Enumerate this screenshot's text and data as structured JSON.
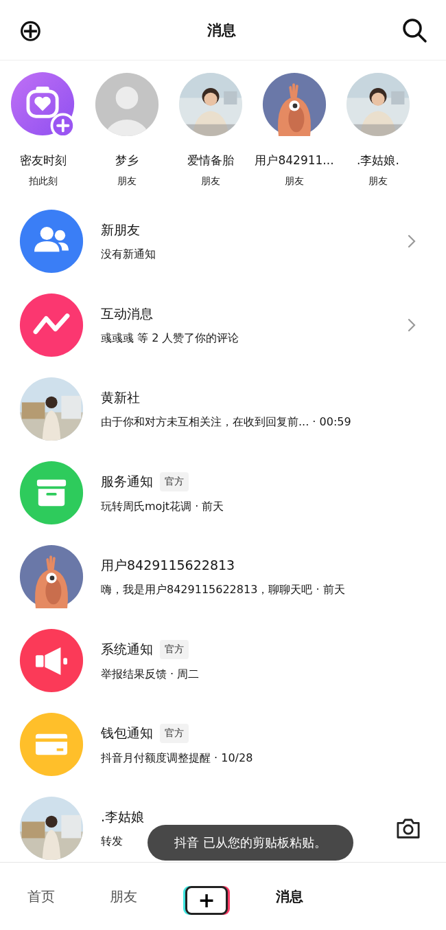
{
  "header": {
    "title": "消息",
    "add_icon": "⊕"
  },
  "stories": [
    {
      "kind": "moment",
      "name": "密友时刻",
      "sub": "拍此刻"
    },
    {
      "kind": "default",
      "name": "梦乡",
      "sub": "朋友"
    },
    {
      "name": "爱情备胎",
      "sub": "朋友"
    },
    {
      "kind": "creature",
      "name": "用户842911...",
      "sub": "朋友"
    },
    {
      "name": ".李姑娘.",
      "sub": "朋友"
    }
  ],
  "conversations": [
    {
      "kind": "friends",
      "color": "#3a7ef6",
      "name": "新朋友",
      "message": "没有新通知",
      "trailing": {
        "kind": "chevron"
      }
    },
    {
      "kind": "interactions",
      "color": "#fb3770",
      "name": "互动消息",
      "message": "彧彧彧 等 2 人赞了你的评论",
      "trailing": {
        "kind": "chevron"
      }
    },
    {
      "name": "黄新社",
      "message": "由于你和对方未互相关注，在收到回复前... · 00:59"
    },
    {
      "kind": "service",
      "color": "#2ecb5c",
      "name": "服务通知",
      "tag": "官方",
      "message": "玩转周氏mojt花调 · 前天"
    },
    {
      "kind": "creature",
      "name": "用户8429115622813",
      "message": "嗨，我是用户8429115622813，聊聊天吧 · 前天"
    },
    {
      "kind": "system",
      "color": "#fb3a58",
      "name": "系统通知",
      "tag": "官方",
      "message": "举报结果反馈 · 周二"
    },
    {
      "kind": "wallet",
      "color": "#ffbf2a",
      "name": "钱包通知",
      "tag": "官方",
      "message": "抖音月付额度调整提醒 · 10/28"
    },
    {
      "name": ".李姑娘",
      "message": "转发",
      "trailing": {
        "kind": "camera"
      }
    }
  ],
  "toast": "抖音 已从您的剪贴板粘贴。",
  "tabs": [
    {
      "kind": "text",
      "label": "首页",
      "selected": false
    },
    {
      "kind": "text",
      "label": "朋友",
      "selected": false
    },
    {
      "kind": "create",
      "label": "+",
      "selected": false
    },
    {
      "kind": "text",
      "label": "消息",
      "selected": true
    }
  ]
}
